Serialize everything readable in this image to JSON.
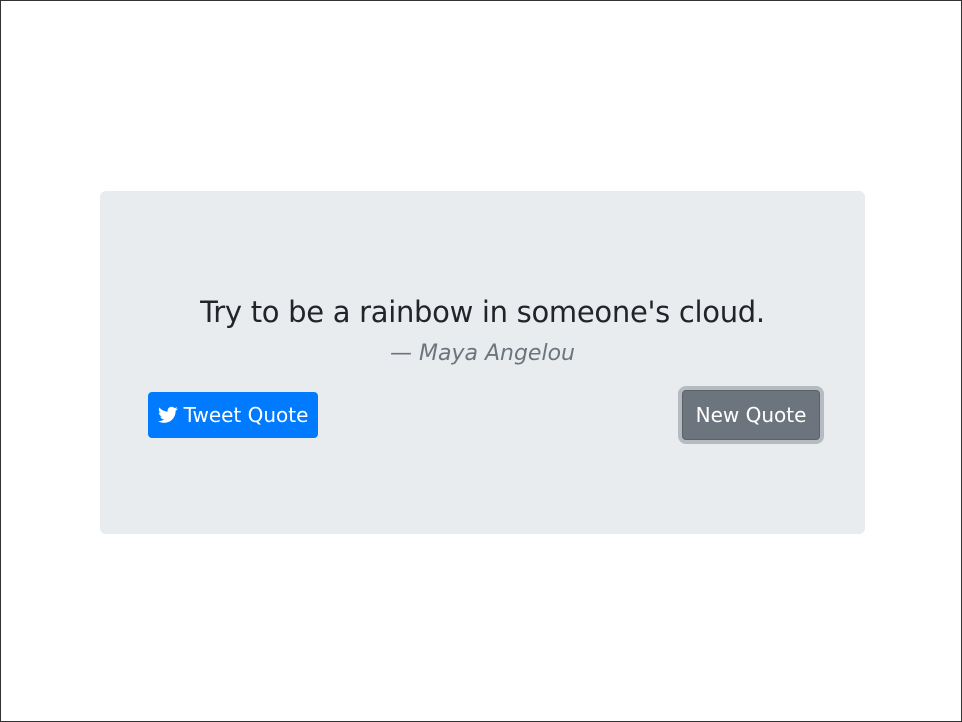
{
  "quote": {
    "text": "Try to be a rainbow in someone's cloud.",
    "author": "— Maya Angelou"
  },
  "buttons": {
    "tweet_label": "Tweet Quote",
    "tweet_icon": "twitter-icon",
    "new_label": "New Quote"
  },
  "colors": {
    "card_background": "#e9ecef",
    "tweet_button": "#007bff",
    "new_button": "#6c757d",
    "quote_text": "#212529",
    "author_text": "#6c757d"
  }
}
